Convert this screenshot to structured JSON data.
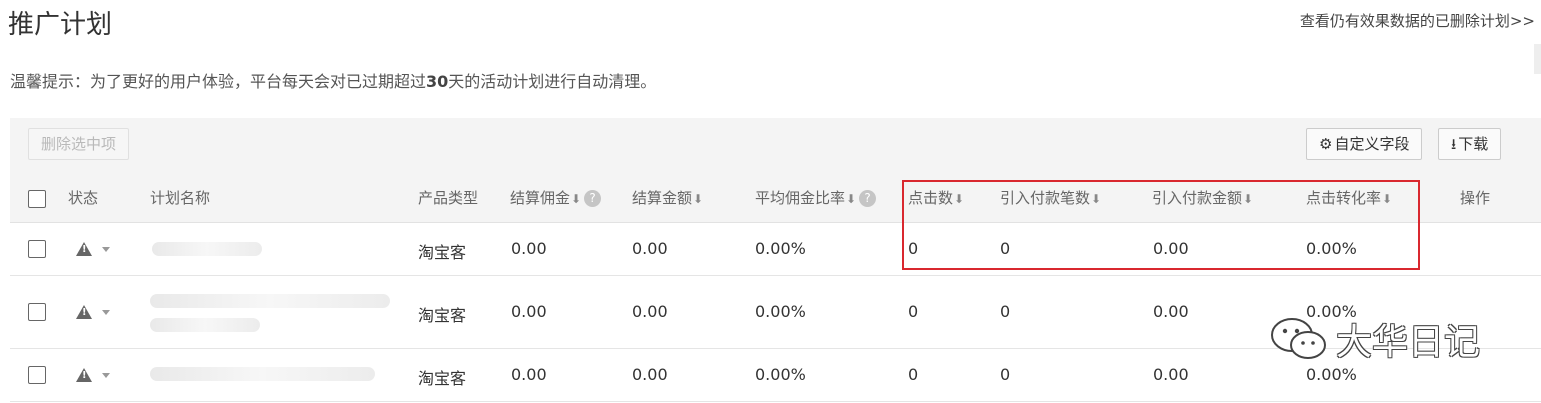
{
  "page": {
    "title": "推广计划",
    "deleted_link": "查看仍有效果数据的已删除计划>>"
  },
  "tip": {
    "prefix": "温馨提示：为了更好的用户体验，平台每天会对已过期超过",
    "days": "30",
    "suffix": "天的活动计划进行自动清理。"
  },
  "toolbar": {
    "delete_label": "删除选中项",
    "custom_fields_label": "自定义字段",
    "download_label": "下载"
  },
  "table": {
    "headers": {
      "status": "状态",
      "plan_name": "计划名称",
      "product_type": "产品类型",
      "settled_commission": "结算佣金",
      "settled_amount": "结算金额",
      "avg_commission_rate": "平均佣金比率",
      "clicks": "点击数",
      "orders": "引入付款笔数",
      "order_amount": "引入付款金额",
      "conversion_rate": "点击转化率",
      "actions": "操作"
    },
    "rows": [
      {
        "product_type": "淘宝客",
        "settled_commission": "0.00",
        "settled_amount": "0.00",
        "avg_commission_rate": "0.00%",
        "clicks": "0",
        "orders": "0",
        "order_amount": "0.00",
        "conversion_rate": "0.00%"
      },
      {
        "product_type": "淘宝客",
        "settled_commission": "0.00",
        "settled_amount": "0.00",
        "avg_commission_rate": "0.00%",
        "clicks": "0",
        "orders": "0",
        "order_amount": "0.00",
        "conversion_rate": "0.00%"
      },
      {
        "product_type": "淘宝客",
        "settled_commission": "0.00",
        "settled_amount": "0.00",
        "avg_commission_rate": "0.00%",
        "clicks": "0",
        "orders": "0",
        "order_amount": "0.00",
        "conversion_rate": "0.00%"
      }
    ]
  },
  "icons": {
    "status": "warning-icon",
    "sort": "sort-down-icon",
    "help": "help-icon",
    "settings": "gear-icon",
    "download": "download-icon"
  },
  "watermark": {
    "text": "大华日记"
  },
  "colors": {
    "highlight": "#d9282f",
    "header_bg": "#f4f4f4"
  }
}
